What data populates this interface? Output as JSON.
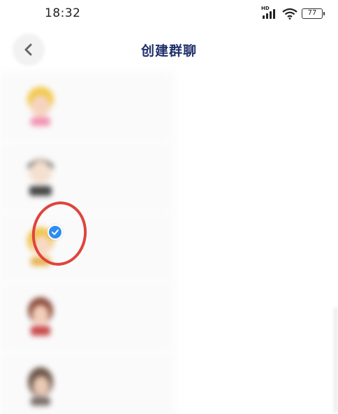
{
  "status_bar": {
    "time": "18:32",
    "network_label": "HD",
    "battery_level": "77"
  },
  "header": {
    "title": "创建群聊",
    "back_icon": "chevron-left-icon"
  },
  "contacts": {
    "item_1": {
      "name": "",
      "selected": false
    },
    "item_2": {
      "name": "",
      "selected": false
    },
    "item_3": {
      "name": "",
      "selected": true
    },
    "item_4": {
      "name": "",
      "selected": false
    },
    "item_5": {
      "name": "",
      "selected": false
    }
  },
  "selection": {
    "check_icon": "check-icon",
    "badge_color": "#2d8cf0",
    "annotation_color": "#e0443e"
  },
  "colors": {
    "title": "#1f2f6b",
    "name": "#3a4a8a",
    "selected_name": "#5aa2e8"
  }
}
